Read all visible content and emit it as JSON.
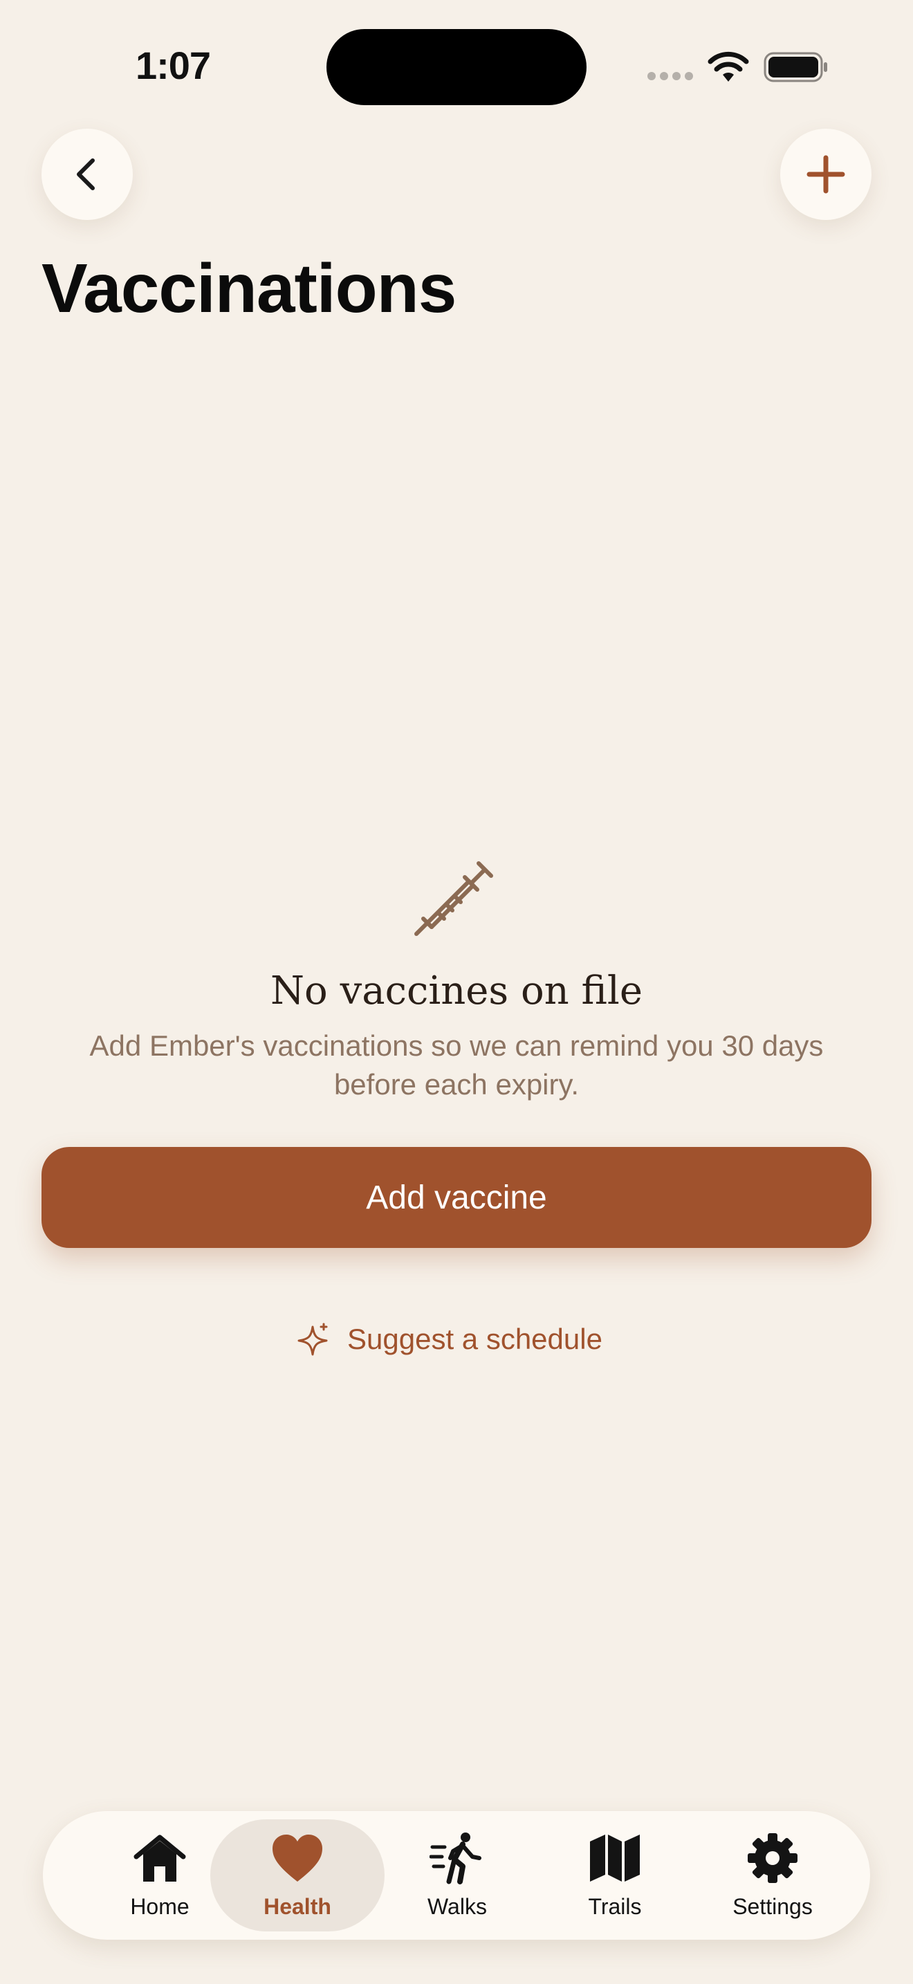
{
  "status_bar": {
    "time": "1:07",
    "icons": [
      "signal-dots-icon",
      "wifi-icon",
      "battery-icon"
    ]
  },
  "header": {
    "back_icon": "chevron-left-icon",
    "add_icon": "plus-icon",
    "title": "Vaccinations"
  },
  "empty_state": {
    "icon": "syringe-icon",
    "title": "No vaccines on file",
    "description": "Add Ember's vaccinations so we can remind you 30 days before each expiry.",
    "primary_action": "Add vaccine",
    "secondary_action": "Suggest a schedule",
    "secondary_icon": "sparkle-icon"
  },
  "tab_bar": {
    "items": [
      {
        "label": "Home",
        "icon": "house-icon"
      },
      {
        "label": "Health",
        "icon": "heart-icon",
        "active": true
      },
      {
        "label": "Walks",
        "icon": "walking-person-icon"
      },
      {
        "label": "Trails",
        "icon": "map-icon"
      },
      {
        "label": "Settings",
        "icon": "gear-icon"
      }
    ]
  },
  "colors": {
    "background": "#F6F0E8",
    "accent": "#A0522D",
    "card": "#FDF9F3",
    "muted_text": "#8D7462",
    "active_tab_bg": "#EBE4DC"
  }
}
